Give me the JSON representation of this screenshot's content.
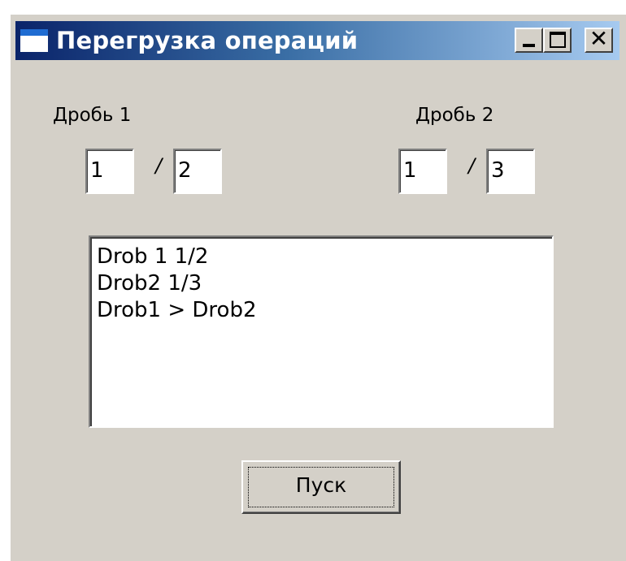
{
  "window": {
    "title": "Перегрузка операций",
    "controls": {
      "minimize": "minimize-icon",
      "maximize": "maximize-icon",
      "close": "close-icon"
    }
  },
  "fraction1": {
    "label": "Дробь 1",
    "numerator": "1",
    "separator": "/",
    "denominator": "2"
  },
  "fraction2": {
    "label": "Дробь 2",
    "numerator": "1",
    "separator": "/",
    "denominator": "3"
  },
  "output": {
    "lines": [
      "Drob 1 1/2",
      "Drob2 1/3",
      "Drob1 > Drob2"
    ]
  },
  "run_button": {
    "label": "Пуск"
  }
}
